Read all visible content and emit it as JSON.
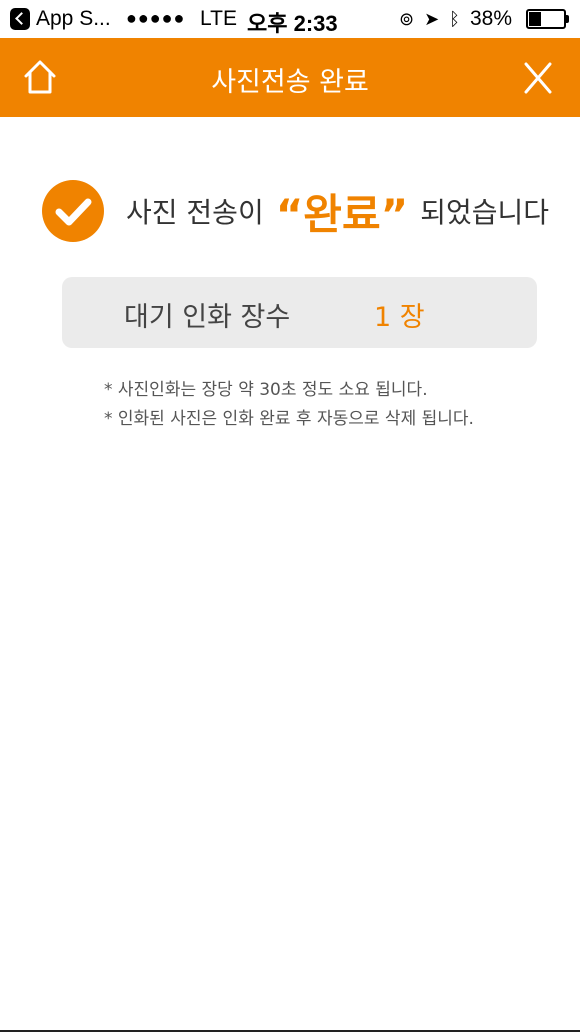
{
  "status_bar": {
    "back_app_label": "App S...",
    "signal": "●●●●●",
    "carrier": "LTE",
    "time": "오후 2:33",
    "battery_percent": "38%",
    "battery_level": 0.38
  },
  "header": {
    "title": "사진전송 완료",
    "close_label": "X",
    "home_icon": "home-icon",
    "accent_color": "#f08300"
  },
  "done": {
    "prefix": "사진 전송이",
    "highlight": "“완료”",
    "suffix": "되었습니다"
  },
  "count": {
    "label": "대기 인화 장수",
    "value": "1 장"
  },
  "notes": [
    "* 사진인화는 장당 약 30초 정도 소요 됩니다.",
    "* 인화된 사진은 인화 완료 후 자동으로 삭제 됩니다."
  ]
}
